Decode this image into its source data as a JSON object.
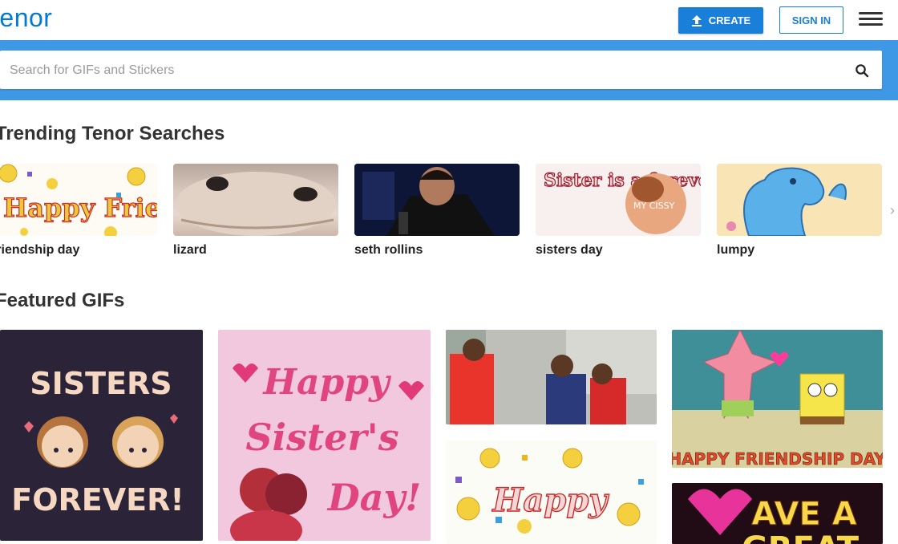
{
  "header": {
    "logo": "tenor",
    "create_label": "CREATE",
    "signin_label": "SIGN IN"
  },
  "search": {
    "placeholder": "Search for GIFs and Stickers"
  },
  "trending": {
    "title": "Trending Tenor Searches",
    "items": [
      {
        "label": "friendship day",
        "thumb_text": "Happy Friendship"
      },
      {
        "label": "lizard"
      },
      {
        "label": "seth rollins"
      },
      {
        "label": "sisters day",
        "thumb_text": "Sister is a forever",
        "thumb_text2": "MY CISSY"
      },
      {
        "label": "lumpy"
      }
    ]
  },
  "featured": {
    "title": "Featured GIFs",
    "gifs": [
      {
        "line1": "SISTERS",
        "line2": "FOREVER!"
      },
      {
        "line1": "Happy",
        "line2": "Sister's",
        "line3": "Day!"
      },
      {},
      {
        "line1": "Happy"
      },
      {
        "caption": "HAPPY FRIENDSHIP DAY"
      },
      {
        "line1": "AVE A",
        "line2": "GREAT"
      }
    ]
  },
  "colors": {
    "brand_blue": "#007bd1",
    "search_band": "#3f98e6",
    "button_blue": "#1a7fd8"
  }
}
